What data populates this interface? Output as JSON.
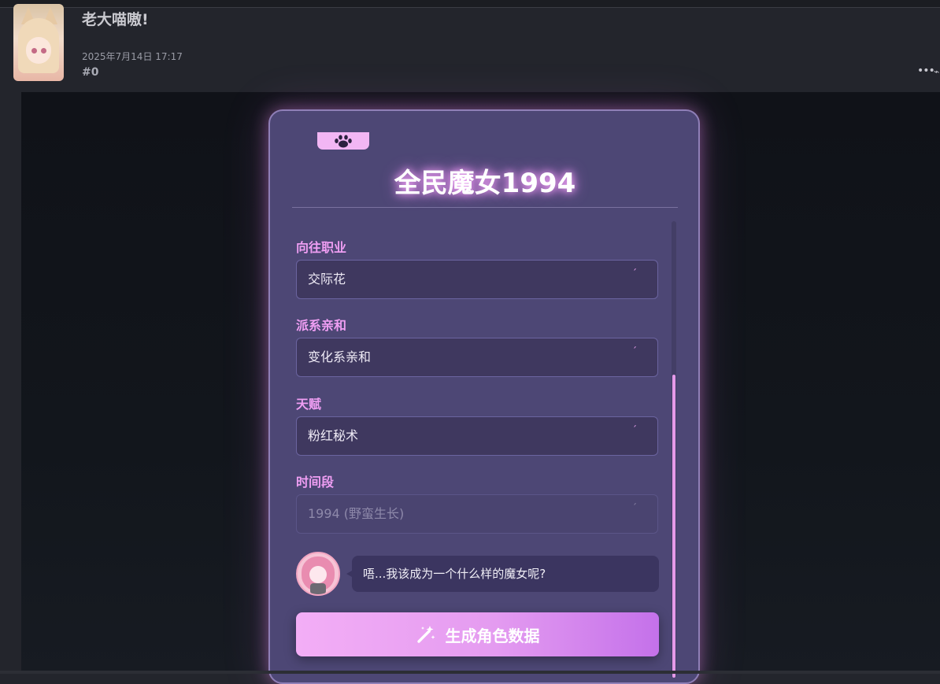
{
  "post": {
    "username": "老大喵嗷!",
    "date": "2025年7月14日 17:17",
    "number": "#0",
    "more_icon": "ellipsis-icon"
  },
  "card": {
    "title": "全民魔女1994",
    "tab_icon": "paw-icon",
    "fields": [
      {
        "label": "向往职业",
        "value": "交际花",
        "disabled": false
      },
      {
        "label": "派系亲和",
        "value": "变化系亲和",
        "disabled": false
      },
      {
        "label": "天赋",
        "value": "粉红秘术",
        "disabled": false
      },
      {
        "label": "时间段",
        "value": "1994 (野蛮生长)",
        "disabled": true
      }
    ],
    "dialog": {
      "avatar_icon": "npc-avatar",
      "text": "唔...我该成为一个什么样的魔女呢?"
    },
    "generate_button": {
      "label": "生成角色数据",
      "icon": "magic-wand-icon"
    }
  },
  "colors": {
    "accent": "#ef9ef3",
    "card_bg": "#4d4775",
    "field_bg": "#3f385f",
    "button_start": "#f3aef6",
    "button_end": "#c471ea"
  }
}
